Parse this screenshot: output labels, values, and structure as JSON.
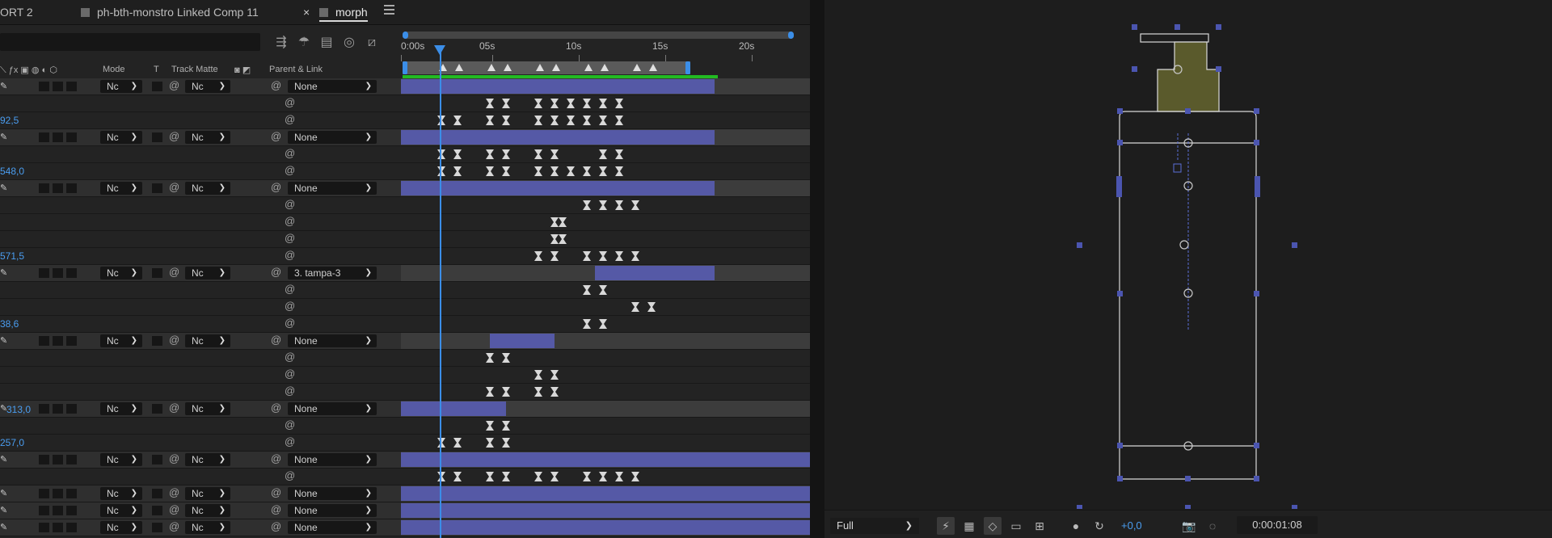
{
  "tabs": [
    {
      "label": "ORT 2"
    },
    {
      "label": "ph-bth-monstro Linked Comp 11"
    },
    {
      "label": "morph",
      "active": true
    }
  ],
  "search": {
    "value": "",
    "placeholder": ""
  },
  "columns": {
    "mode": "Mode",
    "t": "T",
    "track_matte": "Track Matte",
    "parent_link": "Parent & Link"
  },
  "ruler": {
    "labels": [
      "0:00s",
      "05s",
      "10s",
      "15s",
      "20s"
    ]
  },
  "rows": [
    {
      "type": "layer",
      "mode": "Nc",
      "matte": "Nc",
      "parent": "None",
      "bar": [
        0,
        388
      ]
    },
    {
      "type": "prop",
      "kf": [
        110,
        130,
        170,
        190,
        210,
        230,
        250,
        270
      ]
    },
    {
      "type": "prop",
      "value": "92,5",
      "kf": [
        50,
        70,
        110,
        130,
        170,
        190,
        210,
        230,
        250,
        270
      ]
    },
    {
      "type": "layer",
      "mode": "Nc",
      "matte": "Nc",
      "parent": "None",
      "bar": [
        0,
        388
      ]
    },
    {
      "type": "prop",
      "kf": [
        50,
        70,
        110,
        130,
        170,
        190,
        250,
        270
      ]
    },
    {
      "type": "prop",
      "value": "548,0",
      "kf": [
        50,
        70,
        110,
        130,
        170,
        190,
        210,
        230,
        250,
        270
      ]
    },
    {
      "type": "layer",
      "mode": "Nc",
      "matte": "Nc",
      "parent": "None",
      "bar": [
        0,
        388
      ]
    },
    {
      "type": "prop",
      "kf": [
        230,
        250,
        270,
        290
      ]
    },
    {
      "type": "prop",
      "kf": [
        190,
        200
      ]
    },
    {
      "type": "prop",
      "kf": [
        190,
        200
      ]
    },
    {
      "type": "prop",
      "value": "571,5",
      "kf": [
        170,
        190,
        230,
        250,
        270,
        290
      ]
    },
    {
      "type": "layer",
      "mode": "Nc",
      "matte": "Nc",
      "parent": "3. tampa-3",
      "bar": [
        240,
        388
      ]
    },
    {
      "type": "prop",
      "kf": [
        230,
        250
      ]
    },
    {
      "type": "prop",
      "kf": [
        290,
        310
      ]
    },
    {
      "type": "prop",
      "value": "38,6",
      "kf": [
        230,
        250
      ]
    },
    {
      "type": "layer",
      "mode": "Nc",
      "matte": "Nc",
      "parent": "None",
      "bar": [
        110,
        190
      ]
    },
    {
      "type": "prop",
      "kf": [
        110,
        130
      ]
    },
    {
      "type": "prop",
      "kf": [
        170,
        190
      ]
    },
    {
      "type": "prop",
      "kf": [
        110,
        130,
        170,
        190
      ]
    },
    {
      "type": "layer",
      "value": "313,0",
      "mode": "Nc",
      "matte": "Nc",
      "parent": "None",
      "bar": [
        0,
        130
      ]
    },
    {
      "type": "prop",
      "kf": [
        110,
        130
      ]
    },
    {
      "type": "prop",
      "value": "257,0",
      "kf": [
        50,
        70,
        110,
        130
      ]
    },
    {
      "type": "layer",
      "mode": "Nc",
      "matte": "Nc",
      "parent": "None",
      "bar": [
        0,
        506
      ]
    },
    {
      "type": "prop",
      "kf": [
        50,
        70,
        110,
        130,
        170,
        190,
        230,
        250,
        270,
        290
      ]
    },
    {
      "type": "layer",
      "mode": "Nc",
      "matte": "Nc",
      "parent": "None",
      "bar": [
        0,
        506
      ]
    },
    {
      "type": "layer",
      "mode": "Nc",
      "matte": "Nc",
      "parent": "None",
      "bar": [
        0,
        506
      ]
    },
    {
      "type": "layer",
      "mode": "Nc",
      "matte": "Nc",
      "parent": "None",
      "bar": [
        0,
        506
      ]
    }
  ],
  "viewer": {
    "resolution": "Full",
    "exposure": "+0,0",
    "timecode": "0:00:01:08"
  },
  "colors": {
    "accent": "#3b8ee8",
    "layer_bar": "#5559a6",
    "work_area": "#22bb22",
    "bottle_cap": "#5a5a2c"
  }
}
